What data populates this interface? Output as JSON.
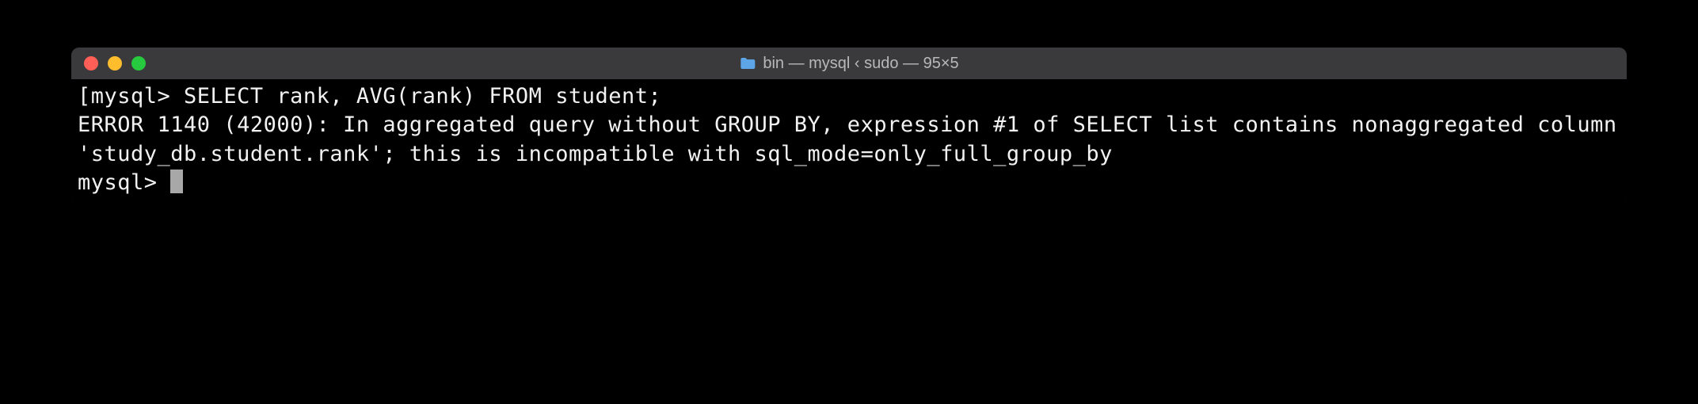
{
  "window": {
    "title": "bin — mysql ‹ sudo — 95×5"
  },
  "terminal": {
    "line1_prompt": "[mysql> ",
    "line1_command": "SELECT rank, AVG(rank) FROM student;",
    "error_text": "ERROR 1140 (42000): In aggregated query without GROUP BY, expression #1 of SELECT list contains nonaggregated column 'study_db.student.rank'; this is incompatible with sql_mode=only_full_group_by",
    "line2_prompt": "mysql> "
  }
}
